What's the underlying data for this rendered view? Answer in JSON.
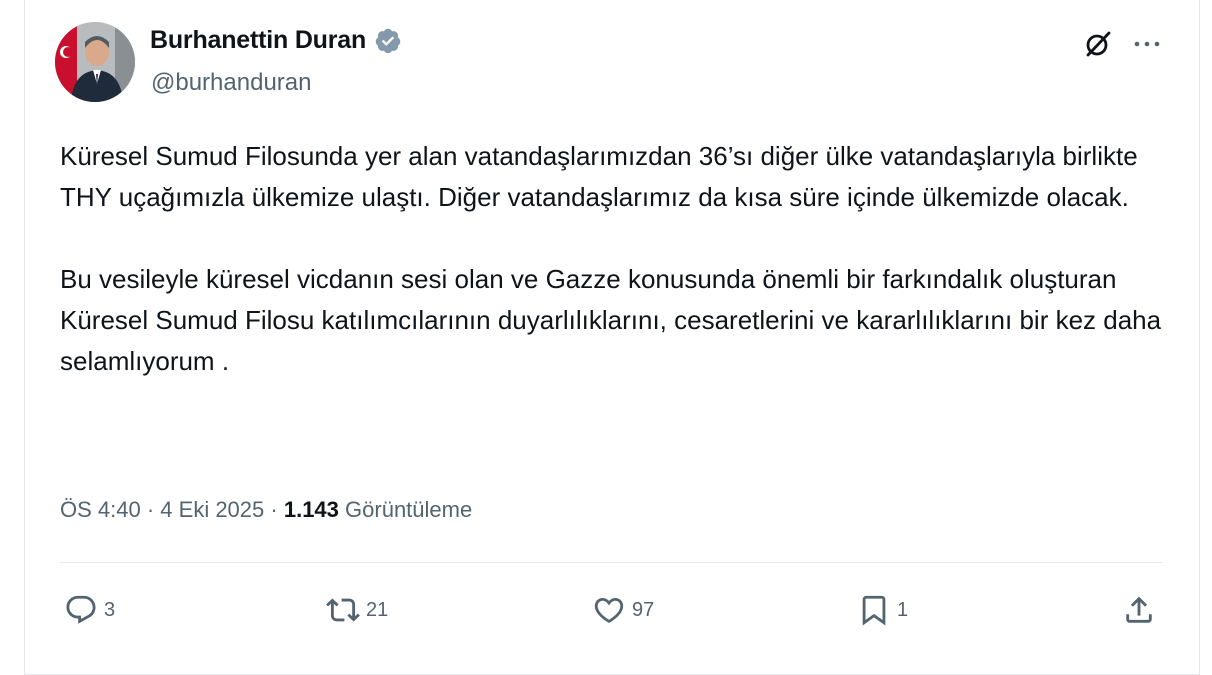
{
  "author": {
    "display_name": "Burhanettin Duran",
    "handle": "@burhanduran",
    "verified": true,
    "verified_color": "#829aab"
  },
  "tweet": {
    "paragraphs": [
      "Küresel Sumud Filosunda yer alan vatandaşlarımızdan 36’sı diğer ülke vatandaşlarıyla birlikte THY uçağımızla ülkemize ulaştı. Diğer vatandaşlarımız da kısa süre içinde ülkemizde olacak.",
      "Bu vesileyle küresel vicdanın sesi olan ve Gazze konusunda önemli bir farkındalık oluşturan Küresel Sumud Filosu katılımcılarının duyarlılıklarını, cesaretlerini ve kararlılıklarını bir kez daha selamlıyorum ."
    ]
  },
  "meta": {
    "time": "ÖS 4:40",
    "separator": "·",
    "date": "4 Eki 2025",
    "views_count": "1.143",
    "views_label": "Görüntüleme"
  },
  "actions": {
    "reply_count": "3",
    "retweet_count": "21",
    "like_count": "97",
    "bookmark_count": "1"
  },
  "icons": {
    "grok": "grok-icon",
    "more": "more-icon",
    "reply": "reply-icon",
    "retweet": "retweet-icon",
    "like": "heart-icon",
    "bookmark": "bookmark-icon",
    "share": "share-icon"
  },
  "colors": {
    "text_primary": "#0f1419",
    "text_secondary": "#536471",
    "divider": "#e6e9eb"
  }
}
